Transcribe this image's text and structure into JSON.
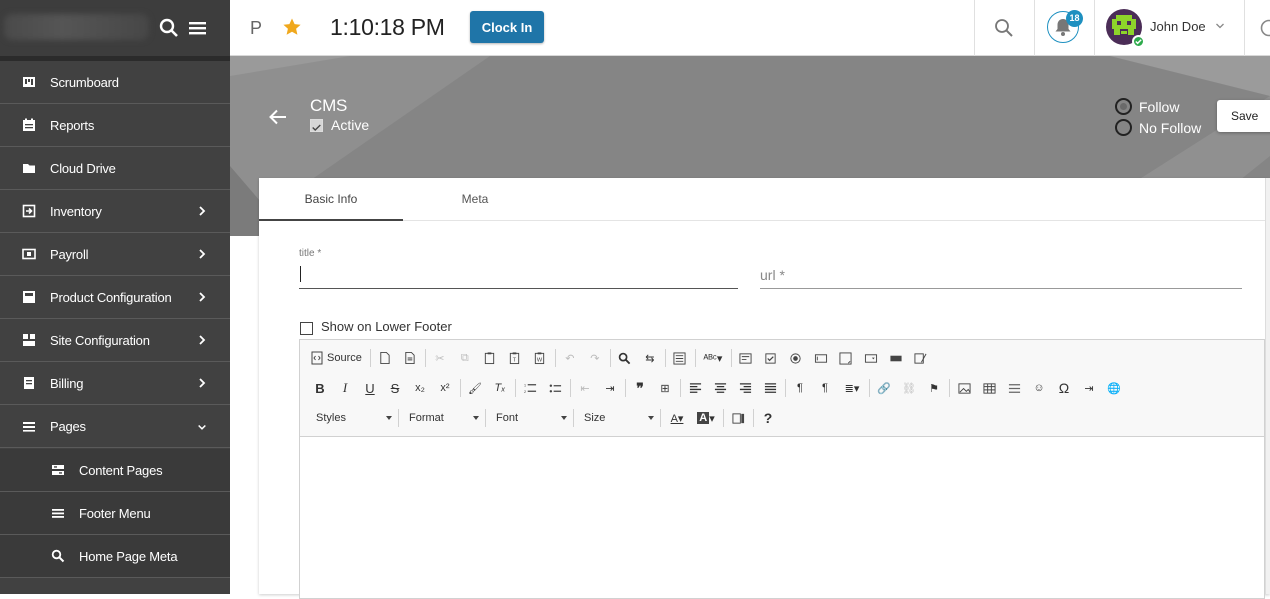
{
  "sidebar": {
    "items": [
      {
        "label": "Scrumboard",
        "icon": "scrumboard-icon",
        "arrow": ""
      },
      {
        "label": "Reports",
        "icon": "reports-icon",
        "arrow": ""
      },
      {
        "label": "Cloud Drive",
        "icon": "folder-icon",
        "arrow": ""
      },
      {
        "label": "Inventory",
        "icon": "inventory-icon",
        "arrow": "right"
      },
      {
        "label": "Payroll",
        "icon": "payroll-icon",
        "arrow": "right"
      },
      {
        "label": "Product Configuration",
        "icon": "product-config-icon",
        "arrow": "right"
      },
      {
        "label": "Site Configuration",
        "icon": "site-config-icon",
        "arrow": "right"
      },
      {
        "label": "Billing",
        "icon": "billing-icon",
        "arrow": "right"
      },
      {
        "label": "Pages",
        "icon": "pages-icon",
        "arrow": "down"
      }
    ],
    "subitems": [
      {
        "label": "Content Pages",
        "icon": "content-pages-icon"
      },
      {
        "label": "Footer Menu",
        "icon": "footer-menu-icon"
      },
      {
        "label": "Home Page Meta",
        "icon": "search-icon"
      }
    ]
  },
  "topbar": {
    "p_label": "P",
    "clock": "1:10:18 PM",
    "clock_in": "Clock In",
    "notification_count": "18",
    "user_name": "John Doe"
  },
  "header": {
    "title": "CMS",
    "active_label": "Active",
    "active_checked": true,
    "follow_label": "Follow",
    "nofollow_label": "No Follow",
    "follow_selected": "Follow",
    "save_label": "Save"
  },
  "tabs": [
    {
      "label": "Basic Info",
      "selected": true
    },
    {
      "label": "Meta",
      "selected": false
    }
  ],
  "form": {
    "title_label": "title *",
    "title_value": "",
    "url_placeholder": "url *",
    "show_footer_label": "Show on Lower Footer",
    "show_footer_checked": false
  },
  "editor": {
    "source_label": "Source",
    "combos": [
      {
        "label": "Styles"
      },
      {
        "label": "Format"
      },
      {
        "label": "Font"
      },
      {
        "label": "Size"
      }
    ]
  },
  "colors": {
    "sidebar": "#414141",
    "accent": "#1f75a8",
    "badge": "#1e90c0",
    "star": "#f0a81d",
    "hero": "#858585",
    "online": "#2eaa4c"
  }
}
